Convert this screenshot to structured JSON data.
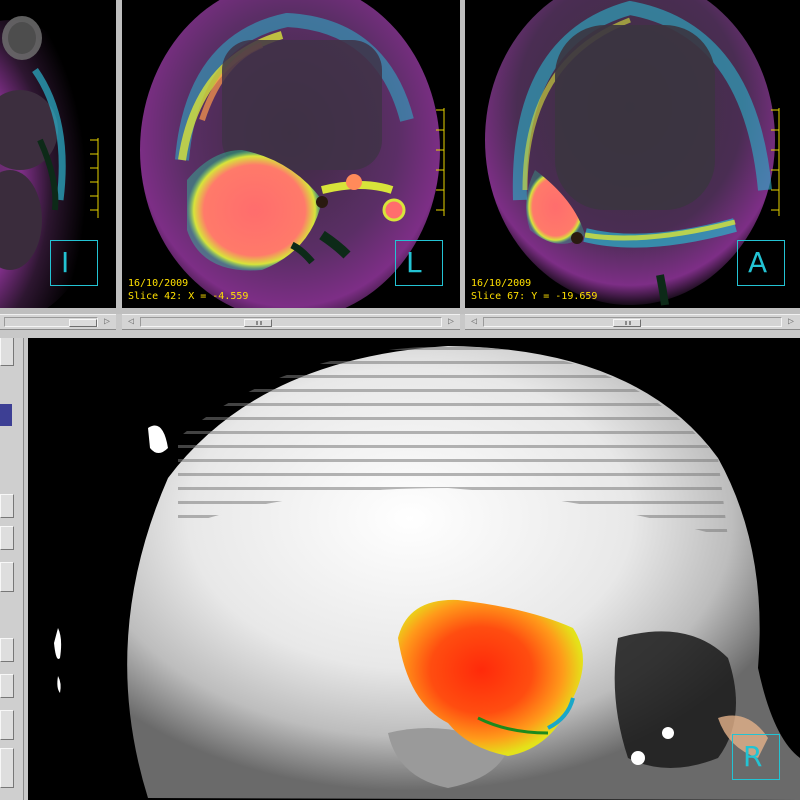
{
  "viewports": {
    "axial": {
      "orientation": "I"
    },
    "sagittal": {
      "date": "16/10/2009",
      "slice": "Slice 42: X = -4.559",
      "orientation": "L"
    },
    "coronal": {
      "date": "16/10/2009",
      "slice": "Slice 67: Y = -19.659",
      "orientation": "A"
    },
    "volume_3d": {
      "orientation": "R"
    }
  },
  "scrollbars": {
    "axial_thumb_fraction": 1.0,
    "sagittal_thumb_fraction": 0.38,
    "coronal_thumb_fraction": 0.48
  },
  "colors": {
    "overlay_text": "#ffe000",
    "orientation_box": "#23c3d3",
    "ruler": "#e7d400",
    "hot_spot": "#ff6d6d"
  }
}
